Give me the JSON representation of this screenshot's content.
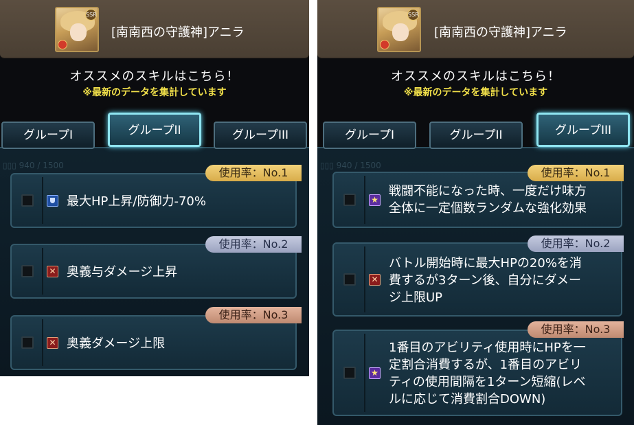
{
  "panels": [
    {
      "character": {
        "name": "[南南西の守護神]アニラ",
        "rarity": "SSR"
      },
      "subtitle": "オススメのスキルはこちら！",
      "note": "※最新のデータを集計しています",
      "tabs": [
        "グループI",
        "グループII",
        "グループIII"
      ],
      "active_tab": 1,
      "skills": [
        {
          "rank": "使用率：No.1",
          "icon": "shield-icon",
          "text": "最大HP上昇/防御力-70%"
        },
        {
          "rank": "使用率：No.2",
          "icon": "ougi-icon",
          "text": "奥義与ダメージ上昇"
        },
        {
          "rank": "使用率：No.3",
          "icon": "ougi-icon",
          "text": "奥義ダメージ上限"
        }
      ]
    },
    {
      "character": {
        "name": "[南南西の守護神]アニラ",
        "rarity": "SSR"
      },
      "subtitle": "オススメのスキルはこちら！",
      "note": "※最新のデータを集計しています",
      "tabs": [
        "グループI",
        "グループII",
        "グループIII"
      ],
      "active_tab": 2,
      "skills": [
        {
          "rank": "使用率：No.1",
          "icon": "star-icon",
          "lines": [
            "戦闘不能になった時、一度だけ味方",
            "全体に一定個数ランダムな強化効果"
          ]
        },
        {
          "rank": "使用率：No.2",
          "icon": "ougi-icon",
          "lines": [
            "バトル開始時に最大HPの20%を消",
            "費するが3ターン後、自分にダメー",
            "ジ上限UP"
          ]
        },
        {
          "rank": "使用率：No.3",
          "icon": "star-icon",
          "lines": [
            "1番目のアビリティ使用時にHPを一",
            "定割合消費するが、1番目のアビリ",
            "ティの使用間隔を1ターン短縮(レベ",
            "ルに応じて消費割合DOWN)"
          ]
        }
      ]
    }
  ],
  "colors": {
    "gold": "#f2d27a",
    "silver": "#c5cbe0",
    "bronze": "#e3b39c",
    "note": "#f2e14a",
    "active_tab_border": "#8fe4f0"
  }
}
